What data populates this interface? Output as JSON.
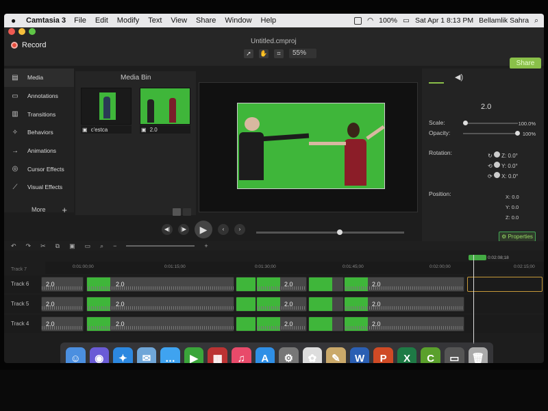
{
  "menubar": {
    "app": "Camtasia 3",
    "items": [
      "File",
      "Edit",
      "Modify",
      "Text",
      "View",
      "Share",
      "Window",
      "Help"
    ],
    "battery": "100%",
    "datetime": "Sat Apr 1  8:13 PM",
    "user": "Bellamlik Sahra"
  },
  "toolbar": {
    "record_label": "Record",
    "filename": "Untitled.cmproj",
    "zoom": "55%",
    "share_label": "Share"
  },
  "sidebar": {
    "items": [
      {
        "label": "Media",
        "icon": "media-icon"
      },
      {
        "label": "Annotations",
        "icon": "annotation-icon"
      },
      {
        "label": "Transitions",
        "icon": "transition-icon"
      },
      {
        "label": "Behaviors",
        "icon": "behavior-icon"
      },
      {
        "label": "Animations",
        "icon": "animation-icon"
      },
      {
        "label": "Cursor Effects",
        "icon": "cursor-icon"
      },
      {
        "label": "Visual Effects",
        "icon": "effects-icon"
      }
    ],
    "more_label": "More",
    "add_label": "+"
  },
  "media_bin": {
    "title": "Media Bin",
    "items": [
      {
        "label": "c'estca"
      },
      {
        "label": "2.0"
      }
    ]
  },
  "properties": {
    "title": "2.0",
    "scale_label": "Scale:",
    "scale_value": "100.0%",
    "opacity_label": "Opacity:",
    "opacity_value": "100%",
    "rotation_label": "Rotation:",
    "rot_z_label": "Z:",
    "rot_z": "0.0°",
    "rot_y_label": "Y:",
    "rot_y": "0.0°",
    "rot_x_label": "X:",
    "rot_x": "0.0°",
    "position_label": "Position:",
    "pos_x_label": "X:",
    "pos_x": "0.0",
    "pos_y_label": "Y:",
    "pos_y": "0.0",
    "pos_z_label": "Z:",
    "pos_z": "0.0",
    "button_label": "Properties"
  },
  "timeline": {
    "ruler": [
      "0:01:00;00",
      "0:01:15;00",
      "0:01:30;00",
      "0:01:45;00",
      "0:02:00;00",
      "0:02:15;00"
    ],
    "playhead_time": "0:02:08;18",
    "track7_label": "Track 7",
    "tracks": [
      {
        "name": "Track 6",
        "clips": [
          {
            "label": "2.0"
          },
          {
            "label": "2.0"
          },
          {
            "label": ""
          },
          {
            "label": "2.0"
          },
          {
            "label": ""
          },
          {
            "label": "2.0"
          }
        ]
      },
      {
        "name": "Track 5",
        "clips": [
          {
            "label": "2.0"
          },
          {
            "label": "2.0"
          },
          {
            "label": ""
          },
          {
            "label": "2.0"
          },
          {
            "label": ""
          },
          {
            "label": "2.0"
          }
        ]
      },
      {
        "name": "Track 4",
        "clips": [
          {
            "label": "2.0"
          },
          {
            "label": "2.0"
          },
          {
            "label": ""
          },
          {
            "label": "2.0"
          },
          {
            "label": ""
          },
          {
            "label": "2.0"
          }
        ]
      }
    ]
  },
  "dock": [
    {
      "icon": "finder-icon",
      "color": "#4b8fe0",
      "glyph": "☺"
    },
    {
      "icon": "siri-icon",
      "color": "#6a5bd6",
      "glyph": "◉"
    },
    {
      "icon": "safari-icon",
      "color": "#2c88e0",
      "glyph": "✦"
    },
    {
      "icon": "mail-icon",
      "color": "#6fa6d8",
      "glyph": "✉"
    },
    {
      "icon": "messages-icon",
      "color": "#3fa3f0",
      "glyph": "…"
    },
    {
      "icon": "facetime-icon",
      "color": "#3aa53a",
      "glyph": "▶"
    },
    {
      "icon": "photo-booth-icon",
      "color": "#b33",
      "glyph": "▦"
    },
    {
      "icon": "music-icon",
      "color": "#e84a6a",
      "glyph": "♫"
    },
    {
      "icon": "app-store-icon",
      "color": "#2f8fe6",
      "glyph": "A"
    },
    {
      "icon": "settings-icon",
      "color": "#777",
      "glyph": "⚙"
    },
    {
      "icon": "photos-icon",
      "color": "#ddd",
      "glyph": "✿"
    },
    {
      "icon": "preview-icon",
      "color": "#caa96a",
      "glyph": "✎"
    },
    {
      "icon": "word-icon",
      "color": "#2b5fb3",
      "glyph": "W"
    },
    {
      "icon": "powerpoint-icon",
      "color": "#cf4a25",
      "glyph": "P"
    },
    {
      "icon": "excel-icon",
      "color": "#1e7a45",
      "glyph": "X"
    },
    {
      "icon": "camtasia-icon",
      "color": "#5aa02c",
      "glyph": "C"
    },
    {
      "icon": "screen-icon",
      "color": "#555",
      "glyph": "▭"
    },
    {
      "icon": "trash-icon",
      "color": "#aaa",
      "glyph": "🗑"
    }
  ]
}
